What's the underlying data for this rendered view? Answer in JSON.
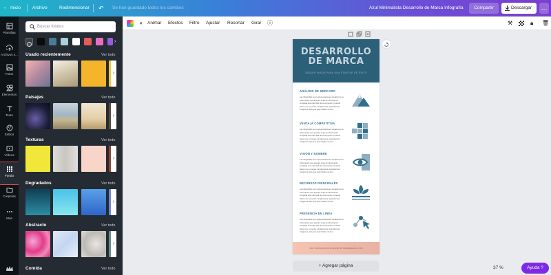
{
  "topbar": {
    "home": "Inicio",
    "file": "Archivo",
    "resize": "Redimensionar",
    "saved_status": "Se han guardado todos los cambios",
    "doc_title": "Azul Minimalista Desarrollo de Marca Infografía",
    "share": "Compartir",
    "download": "Descargar"
  },
  "rail": {
    "items": [
      {
        "label": "Plantillas",
        "icon": "templates-icon"
      },
      {
        "label": "Archivos s...",
        "icon": "upload-icon"
      },
      {
        "label": "Fotos",
        "icon": "photos-icon"
      },
      {
        "label": "Elementos",
        "icon": "elements-icon"
      },
      {
        "label": "Texto",
        "icon": "text-icon"
      },
      {
        "label": "Estilos",
        "icon": "styles-icon"
      },
      {
        "label": "Vídeos",
        "icon": "video-icon"
      },
      {
        "label": "Fondo",
        "icon": "background-icon"
      },
      {
        "label": "Carpetas",
        "icon": "folder-icon"
      },
      {
        "label": "Más",
        "icon": "more-icon"
      }
    ]
  },
  "panel": {
    "search_placeholder": "Buscar fondos",
    "colors": [
      "#0b0b0b",
      "#4a7b95",
      "#a8d1db",
      "#ffffff",
      "#e85a5a",
      "#e86ec4",
      "#9b5ce0"
    ],
    "sections": [
      {
        "title": "Usado recientemente",
        "see_all": "Ver todo"
      },
      {
        "title": "Paisajes",
        "see_all": "Ver todo"
      },
      {
        "title": "Texturas",
        "see_all": "Ver todo"
      },
      {
        "title": "Degradados",
        "see_all": "Ver todo"
      },
      {
        "title": "Abstracto",
        "see_all": "Ver todo"
      },
      {
        "title": "Comida",
        "see_all": "Ver todo"
      }
    ]
  },
  "toolbar": {
    "animate": "Animar",
    "effects": "Efectos",
    "filter": "Filtro",
    "adjust": "Ajustar",
    "crop": "Recortar",
    "flip": "Girar"
  },
  "infographic": {
    "title_line1": "DESARROLLO",
    "title_line2": "DE MARCA",
    "subtitle": "SEGUIR PASOS PARA UNA STARTUP DE ÉXITO",
    "sections": [
      {
        "heading": "ANÁLISIS DE MERCADO",
        "icon": "mountain-icon"
      },
      {
        "heading": "VENTAJA COMPETITIVA",
        "icon": "grid-squares-icon"
      },
      {
        "heading": "VISIÓN Y NOMBRE",
        "icon": "eye-icon"
      },
      {
        "heading": "RECURSOS PRINCIPALES",
        "icon": "plant-icon"
      },
      {
        "heading": "PRESENCIA EN LÍNEA",
        "icon": "network-cursor-icon"
      }
    ],
    "body_text": "Las infografías son representaciones visuales de la información que ayudan a que la información compleja sea más fácil de comprender. Cuando haces uno, procura, simplemente organizar las imágenes para que sean fáciles de leer.",
    "footer": "MÁS INFORMACIÓN EN WWW.SITIOWEBGENIAL.COM"
  },
  "canvas": {
    "add_page": "+ Agregar página",
    "zoom": "37 %",
    "help": "Ayuda ?"
  }
}
